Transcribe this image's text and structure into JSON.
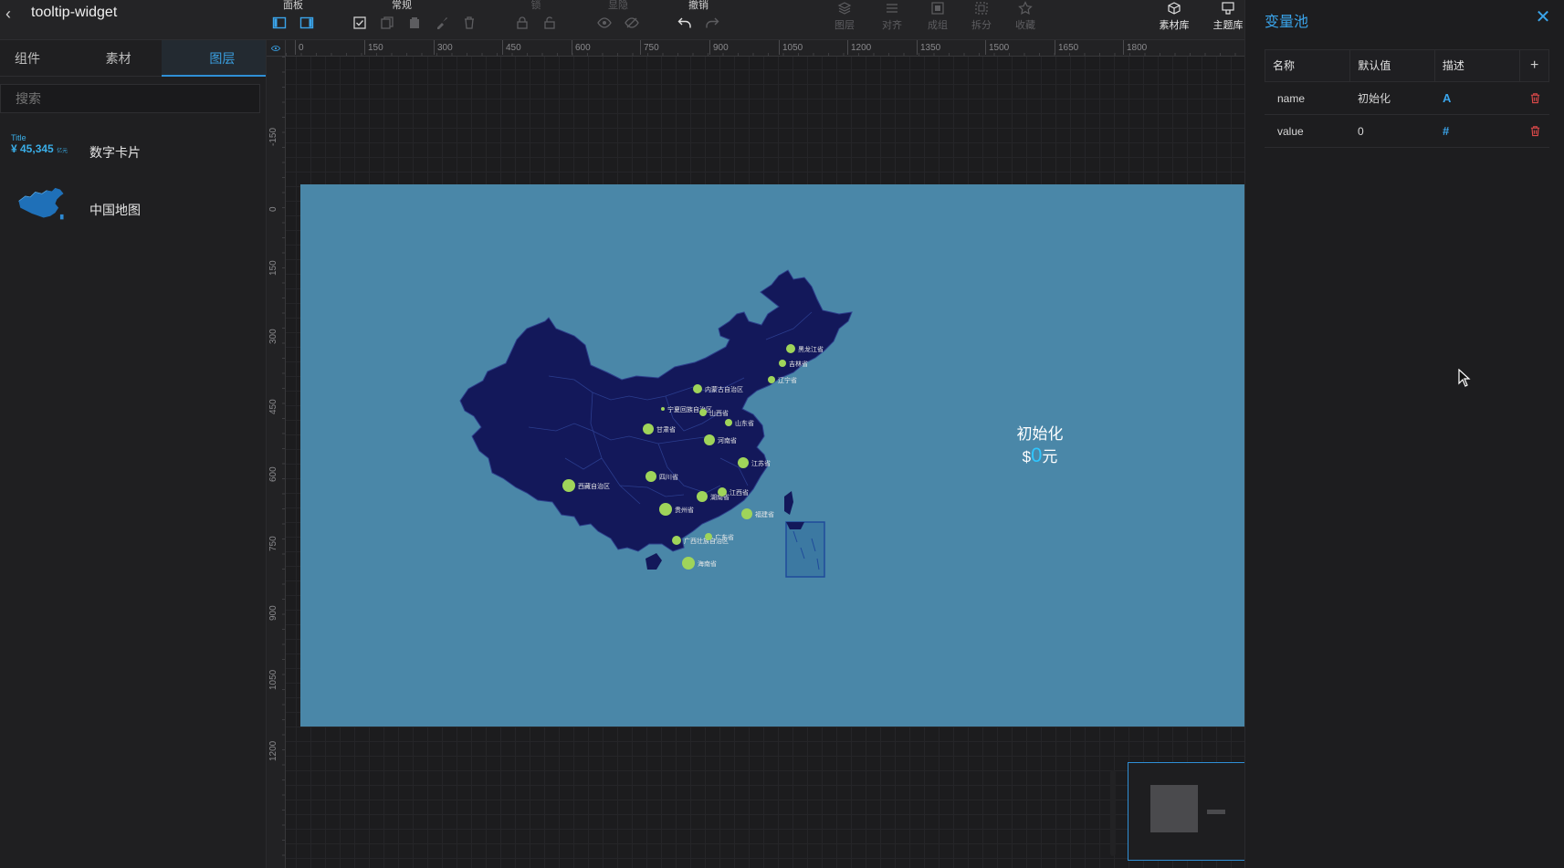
{
  "app": {
    "title": "tooltip-widget"
  },
  "toolbar": {
    "groups": [
      {
        "label": "面板",
        "dim": false
      },
      {
        "label": "常规",
        "dim": false
      },
      {
        "label": "锁",
        "dim": true
      },
      {
        "label": "显隐",
        "dim": true
      },
      {
        "label": "撤销",
        "dim": false
      }
    ],
    "buttons_right": [
      {
        "label": "图层",
        "on": false
      },
      {
        "label": "对齐",
        "on": false
      },
      {
        "label": "成组",
        "on": false
      },
      {
        "label": "拆分",
        "on": false
      },
      {
        "label": "收藏",
        "on": false
      },
      {
        "label": "素材库",
        "on": true
      },
      {
        "label": "主题库",
        "on": true
      }
    ]
  },
  "left_panel": {
    "tabs": [
      {
        "label": "组件",
        "active": false
      },
      {
        "label": "素材",
        "active": false
      },
      {
        "label": "图层",
        "active": true
      }
    ],
    "search_placeholder": "搜索",
    "layers": [
      {
        "name": "数字卡片",
        "thumb_title": "Title",
        "thumb_value": "¥ 45,345",
        "thumb_unit": "亿元"
      },
      {
        "name": "中国地图"
      }
    ]
  },
  "rulers": {
    "h_ticks": [
      "0",
      "150",
      "300",
      "450",
      "600",
      "750",
      "900",
      "1050",
      "1200",
      "1350",
      "1500",
      "1650",
      "1800"
    ],
    "v_ticks": [
      "-150",
      "0",
      "150",
      "300",
      "450",
      "600",
      "750",
      "900",
      "1050",
      "1200"
    ]
  },
  "canvas": {
    "provinces": [
      {
        "name": "黑龙江省"
      },
      {
        "name": "吉林省"
      },
      {
        "name": "辽宁省"
      },
      {
        "name": "内蒙古自治区"
      },
      {
        "name": "宁夏回族自治区"
      },
      {
        "name": "山西省"
      },
      {
        "name": "山东省"
      },
      {
        "name": "甘肃省"
      },
      {
        "name": "河南省"
      },
      {
        "name": "江苏省"
      },
      {
        "name": "四川省"
      },
      {
        "name": "西藏自治区"
      },
      {
        "name": "湖南省"
      },
      {
        "name": "江西省"
      },
      {
        "name": "贵州省"
      },
      {
        "name": "福建省"
      },
      {
        "name": "广西壮族自治区"
      },
      {
        "name": "广东省"
      },
      {
        "name": "海南省"
      }
    ],
    "tooltip": {
      "name": "初始化",
      "prefix": "$",
      "value": "0",
      "unit": "元"
    }
  },
  "variable_pool": {
    "title": "变量池",
    "columns": [
      "名称",
      "默认值",
      "描述"
    ],
    "rows": [
      {
        "name": "name",
        "default": "初始化",
        "type_icon": "A"
      },
      {
        "name": "value",
        "default": "0",
        "type_icon": "#"
      }
    ]
  },
  "colors": {
    "accent": "#3aa4ea",
    "stage": "#4a87a8",
    "map": "#13185a",
    "marker": "#9fd45a",
    "delete": "#e04a4a"
  }
}
